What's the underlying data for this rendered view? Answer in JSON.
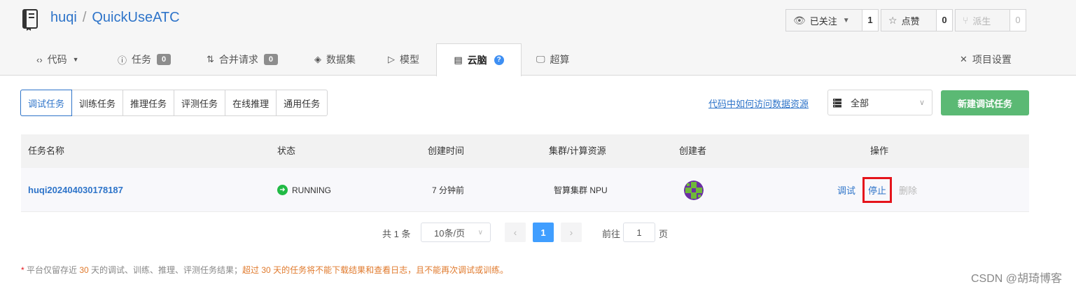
{
  "repo": {
    "owner": "huqi",
    "separator": "/",
    "name": "QuickUseATC"
  },
  "actions": {
    "watch": {
      "label": "已关注",
      "count": "1"
    },
    "star": {
      "label": "点赞",
      "count": "0"
    },
    "fork": {
      "label": "派生",
      "count": "0"
    }
  },
  "tabs": [
    {
      "label": "代码",
      "icon": "code-icon"
    },
    {
      "label": "任务",
      "icon": "issue-icon",
      "badge": "0"
    },
    {
      "label": "合并请求",
      "icon": "pull-request-icon",
      "badge": "0"
    },
    {
      "label": "数据集",
      "icon": "dataset-icon"
    },
    {
      "label": "模型",
      "icon": "model-icon"
    },
    {
      "label": "云脑",
      "icon": "server-icon",
      "help": "?"
    },
    {
      "label": "超算",
      "icon": "monitor-icon"
    },
    {
      "label": "项目设置",
      "icon": "tools-icon"
    }
  ],
  "task_types": [
    "调试任务",
    "训练任务",
    "推理任务",
    "评测任务",
    "在线推理",
    "通用任务"
  ],
  "doc_link": "代码中如何访问数据资源",
  "filter": {
    "value": "全部"
  },
  "new_button": "新建调试任务",
  "table": {
    "headers": [
      "任务名称",
      "状态",
      "创建时间",
      "集群/计算资源",
      "创建者",
      "操作"
    ],
    "rows": [
      {
        "name": "huqi202404030178187",
        "status": "RUNNING",
        "created": "7 分钟前",
        "resource": "智算集群 NPU",
        "ops": {
          "debug": "调试",
          "stop": "停止",
          "delete": "删除"
        }
      }
    ]
  },
  "pagination": {
    "total": "共 1 条",
    "page_size": "10条/页",
    "prev": "‹",
    "current": "1",
    "next": "›",
    "goto_label": "前往",
    "goto_value": "1",
    "page_suffix": "页"
  },
  "notice": {
    "star": "*",
    "part1": " 平台仅留存近 ",
    "days1": "30",
    "part2": " 天的调试、训练、推理、评测任务结果；",
    "warn": "超过 30 天的任务将不能下载结果和查看日志，且不能再次调试或训练。"
  },
  "watermark": "CSDN @胡琦博客",
  "colors": {
    "link": "#2e74c9",
    "primary_green": "#5bb974",
    "running": "#21ba45",
    "highlight_red": "#e5141b",
    "page_active": "#409eff"
  }
}
